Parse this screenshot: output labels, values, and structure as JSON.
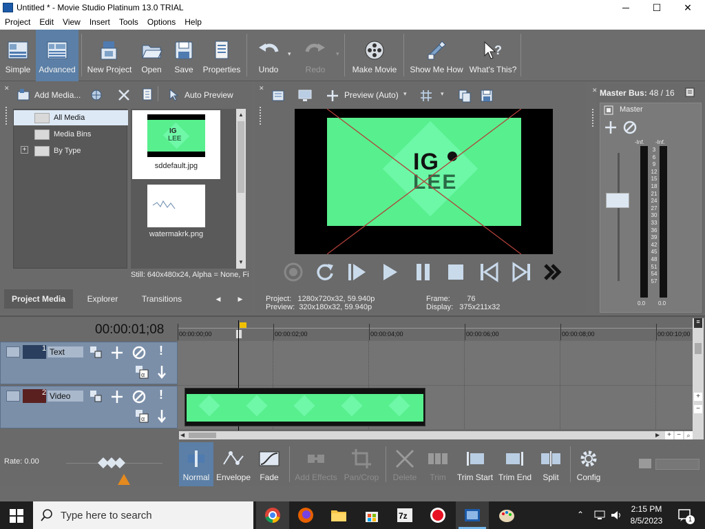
{
  "window": {
    "title": "Untitled * - Movie Studio Platinum 13.0 TRIAL",
    "min": "─",
    "max": "☐",
    "close": "✕"
  },
  "menu": [
    "Project",
    "Edit",
    "View",
    "Insert",
    "Tools",
    "Options",
    "Help"
  ],
  "toolbar": {
    "simple": "Simple",
    "advanced": "Advanced",
    "new_project": "New Project",
    "open": "Open",
    "save": "Save",
    "properties": "Properties",
    "undo": "Undo",
    "redo": "Redo",
    "make_movie": "Make Movie",
    "show_me_how": "Show Me How",
    "whats_this": "What's This?"
  },
  "media": {
    "add_media": "Add Media...",
    "auto_preview": "Auto Preview",
    "tree": [
      {
        "label": "All Media",
        "selected": true
      },
      {
        "label": "Media Bins",
        "selected": false
      },
      {
        "label": "By Type",
        "selected": false
      }
    ],
    "tree_expand": "+",
    "files": [
      {
        "name": "sddefault.jpg"
      },
      {
        "name": "watermakrk.png"
      }
    ],
    "info": "Still: 640x480x24, Alpha = None, Fi"
  },
  "tabs": {
    "project_media": "Project Media",
    "explorer": "Explorer",
    "transitions": "Transitions",
    "prev": "◀",
    "next": "▶"
  },
  "preview": {
    "mode": "Preview (Auto)",
    "project_label": "Project:",
    "project_value": "1280x720x32, 59.940p",
    "preview_label": "Preview:",
    "preview_value": "320x180x32, 59.940p",
    "frame_label": "Frame:",
    "frame_value": "76",
    "display_label": "Display:",
    "display_value": "375x211x32",
    "logo_top": "IG",
    "logo_bottom": "LEE"
  },
  "master": {
    "title": "Master Bus:",
    "value": "48 / 16",
    "label": "Master",
    "inf_l": "-Inf.",
    "inf_r": "-Inf.",
    "scale": [
      "3",
      "6",
      "9",
      "12",
      "15",
      "18",
      "21",
      "24",
      "27",
      "30",
      "33",
      "36",
      "39",
      "42",
      "45",
      "48",
      "51",
      "54",
      "57"
    ],
    "bottom_l": "0.0",
    "bottom_r": "0.0"
  },
  "timeline": {
    "timecode": "00:00:01;08",
    "marks": [
      "00:00:00;00",
      "00:00:02;00",
      "00:00:04;00",
      "00:00:06;00",
      "00:00:08;00",
      "00:00:10;00"
    ],
    "tracks": [
      {
        "num": "1",
        "name": "Text"
      },
      {
        "num": "2",
        "name": "Video"
      }
    ],
    "rate": "Rate: 0.00"
  },
  "bottom": {
    "normal": "Normal",
    "envelope": "Envelope",
    "fade": "Fade",
    "add_effects": "Add Effects",
    "pan_crop": "Pan/Crop",
    "delete": "Delete",
    "trim": "Trim",
    "trim_start": "Trim Start",
    "trim_end": "Trim End",
    "split": "Split",
    "config": "Config"
  },
  "taskbar": {
    "search": "Type here to search",
    "time": "2:15 PM",
    "date": "8/5/2023",
    "notifications": "1"
  }
}
